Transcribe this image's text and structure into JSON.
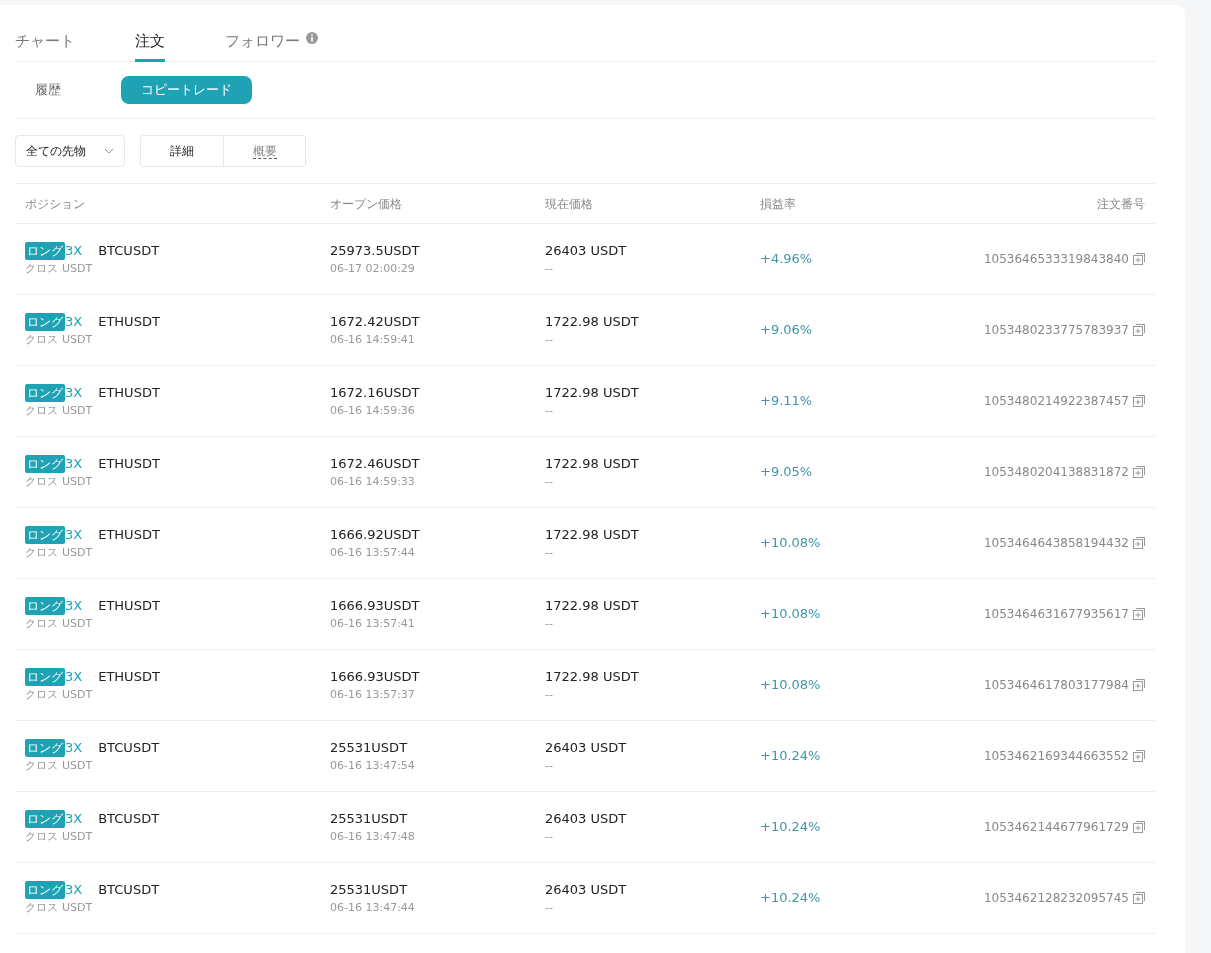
{
  "tabs": [
    {
      "label": "チャート",
      "selected": false
    },
    {
      "label": "注文",
      "selected": true
    },
    {
      "label": "フォロワー",
      "selected": false,
      "info": true
    }
  ],
  "subtabs": [
    {
      "label": "履歴",
      "selected": false
    },
    {
      "label": "コピートレード",
      "selected": true
    }
  ],
  "filter": {
    "value": "全ての先物"
  },
  "view_toggle": [
    {
      "label": "詳細",
      "selected": true
    },
    {
      "label": "概要",
      "selected": false
    }
  ],
  "table": {
    "columns": [
      "ポジション",
      "オープン価格",
      "現在価格",
      "損益率",
      "注文番号"
    ],
    "rows": [
      {
        "side": "ロング",
        "leverage": "3X",
        "symbol": "BTCUSDT",
        "margin": "クロス",
        "margin_coin": "USDT",
        "open_price": "25973.5USDT",
        "open_time": "06-17 02:00:29",
        "current_price": "26403 USDT",
        "current_sub": "--",
        "pnl": "+4.96%",
        "order_id": "1053646533319843840"
      },
      {
        "side": "ロング",
        "leverage": "3X",
        "symbol": "ETHUSDT",
        "margin": "クロス",
        "margin_coin": "USDT",
        "open_price": "1672.42USDT",
        "open_time": "06-16 14:59:41",
        "current_price": "1722.98 USDT",
        "current_sub": "--",
        "pnl": "+9.06%",
        "order_id": "1053480233775783937"
      },
      {
        "side": "ロング",
        "leverage": "3X",
        "symbol": "ETHUSDT",
        "margin": "クロス",
        "margin_coin": "USDT",
        "open_price": "1672.16USDT",
        "open_time": "06-16 14:59:36",
        "current_price": "1722.98 USDT",
        "current_sub": "--",
        "pnl": "+9.11%",
        "order_id": "1053480214922387457"
      },
      {
        "side": "ロング",
        "leverage": "3X",
        "symbol": "ETHUSDT",
        "margin": "クロス",
        "margin_coin": "USDT",
        "open_price": "1672.46USDT",
        "open_time": "06-16 14:59:33",
        "current_price": "1722.98 USDT",
        "current_sub": "--",
        "pnl": "+9.05%",
        "order_id": "1053480204138831872"
      },
      {
        "side": "ロング",
        "leverage": "3X",
        "symbol": "ETHUSDT",
        "margin": "クロス",
        "margin_coin": "USDT",
        "open_price": "1666.92USDT",
        "open_time": "06-16 13:57:44",
        "current_price": "1722.98 USDT",
        "current_sub": "--",
        "pnl": "+10.08%",
        "order_id": "1053464643858194432"
      },
      {
        "side": "ロング",
        "leverage": "3X",
        "symbol": "ETHUSDT",
        "margin": "クロス",
        "margin_coin": "USDT",
        "open_price": "1666.93USDT",
        "open_time": "06-16 13:57:41",
        "current_price": "1722.98 USDT",
        "current_sub": "--",
        "pnl": "+10.08%",
        "order_id": "1053464631677935617"
      },
      {
        "side": "ロング",
        "leverage": "3X",
        "symbol": "ETHUSDT",
        "margin": "クロス",
        "margin_coin": "USDT",
        "open_price": "1666.93USDT",
        "open_time": "06-16 13:57:37",
        "current_price": "1722.98 USDT",
        "current_sub": "--",
        "pnl": "+10.08%",
        "order_id": "1053464617803177984"
      },
      {
        "side": "ロング",
        "leverage": "3X",
        "symbol": "BTCUSDT",
        "margin": "クロス",
        "margin_coin": "USDT",
        "open_price": "25531USDT",
        "open_time": "06-16 13:47:54",
        "current_price": "26403 USDT",
        "current_sub": "--",
        "pnl": "+10.24%",
        "order_id": "1053462169344663552"
      },
      {
        "side": "ロング",
        "leverage": "3X",
        "symbol": "BTCUSDT",
        "margin": "クロス",
        "margin_coin": "USDT",
        "open_price": "25531USDT",
        "open_time": "06-16 13:47:48",
        "current_price": "26403 USDT",
        "current_sub": "--",
        "pnl": "+10.24%",
        "order_id": "1053462144677961729"
      },
      {
        "side": "ロング",
        "leverage": "3X",
        "symbol": "BTCUSDT",
        "margin": "クロス",
        "margin_coin": "USDT",
        "open_price": "25531USDT",
        "open_time": "06-16 13:47:44",
        "current_price": "26403 USDT",
        "current_sub": "--",
        "pnl": "+10.24%",
        "order_id": "1053462128232095745"
      }
    ]
  }
}
